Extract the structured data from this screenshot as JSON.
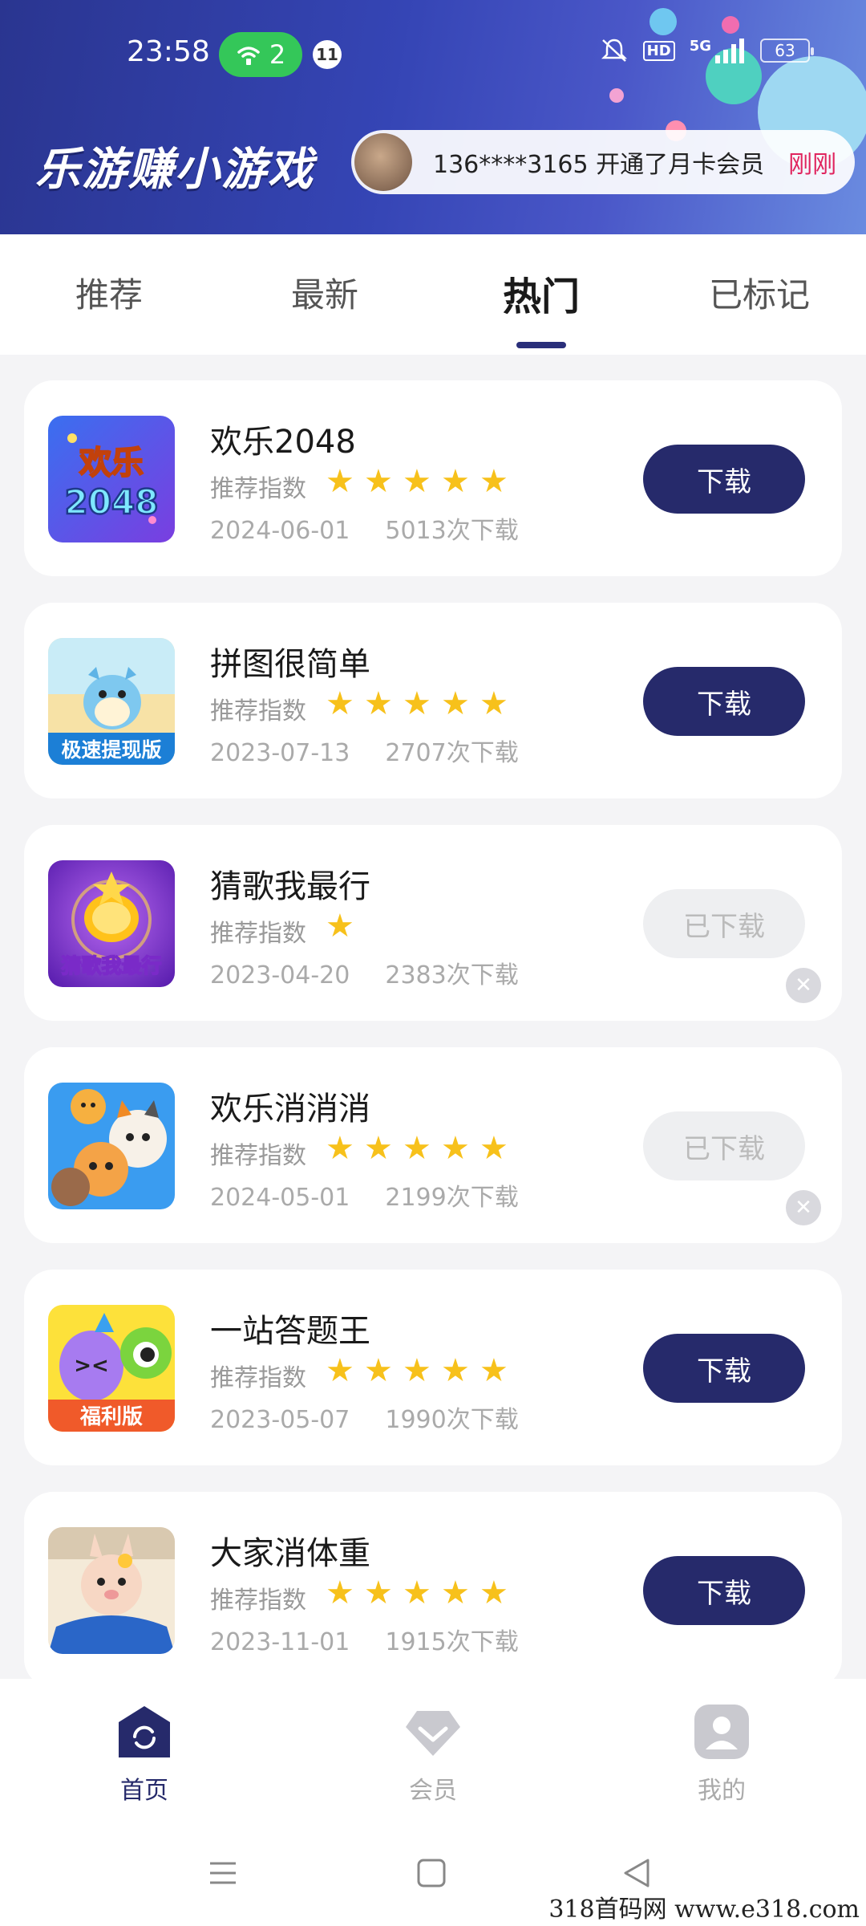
{
  "status": {
    "time": "23:58",
    "wifi_count": "2",
    "notif_count": "11",
    "network": "5G",
    "hd": "HD",
    "battery": "63"
  },
  "header": {
    "brand": "乐游赚小游戏",
    "ticker_text": "136****3165 开通了月卡会员",
    "ticker_time": "刚刚"
  },
  "tabs": [
    {
      "label": "推荐"
    },
    {
      "label": "最新"
    },
    {
      "label": "热门",
      "active": true
    },
    {
      "label": "已标记"
    }
  ],
  "rating_label": "推荐指数",
  "games": [
    {
      "title": "欢乐2048",
      "stars": 5,
      "date": "2024-06-01",
      "downloads": "5013次下载",
      "button": "下载",
      "downloaded": false
    },
    {
      "title": "拼图很简单",
      "stars": 5,
      "date": "2023-07-13",
      "downloads": "2707次下载",
      "button": "下载",
      "downloaded": false
    },
    {
      "title": "猜歌我最行",
      "stars": 1,
      "date": "2023-04-20",
      "downloads": "2383次下载",
      "button": "已下载",
      "downloaded": true
    },
    {
      "title": "欢乐消消消",
      "stars": 5,
      "date": "2024-05-01",
      "downloads": "2199次下载",
      "button": "已下载",
      "downloaded": true
    },
    {
      "title": "一站答题王",
      "stars": 5,
      "date": "2023-05-07",
      "downloads": "1990次下载",
      "button": "下载",
      "downloaded": false
    },
    {
      "title": "大家消体重",
      "stars": 5,
      "date": "2023-11-01",
      "downloads": "1915次下载",
      "button": "下载",
      "downloaded": false
    }
  ],
  "icon_texts": {
    "g0": "欢乐2048",
    "g1": "极速提现版",
    "g2": "猜歌我最行",
    "g4": "福利版"
  },
  "bottom_nav": [
    {
      "label": "首页",
      "icon": "home-icon",
      "active": true
    },
    {
      "label": "会员",
      "icon": "diamond-icon",
      "active": false
    },
    {
      "label": "我的",
      "icon": "profile-icon",
      "active": false
    }
  ],
  "watermark": "318首码网  www.e318.com",
  "colors": {
    "accent": "#262a6b",
    "star": "#f7c11b",
    "ticker_time": "#e0245e"
  }
}
